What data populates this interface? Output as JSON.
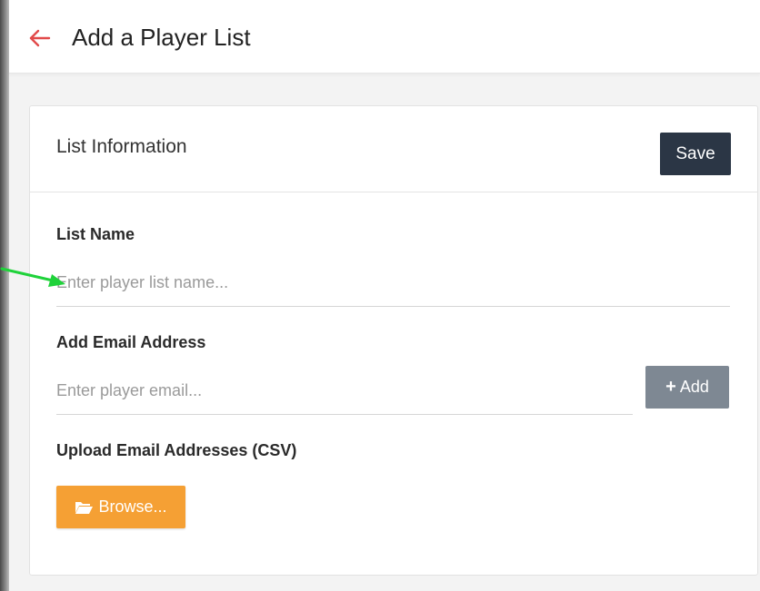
{
  "header": {
    "title": "Add a Player List"
  },
  "card": {
    "title": "List Information",
    "save_label": "Save"
  },
  "list_name": {
    "label": "List Name",
    "placeholder": "Enter player list name...",
    "value": ""
  },
  "email": {
    "label": "Add Email Address",
    "placeholder": "Enter player email...",
    "value": "",
    "add_label": "Add"
  },
  "upload": {
    "label": "Upload Email Addresses (CSV)",
    "browse_label": "Browse..."
  },
  "icons": {
    "back": "arrow-left-icon",
    "add": "plus-icon",
    "browse": "folder-open-icon",
    "annotation": "annotation-arrow"
  },
  "colors": {
    "back_arrow": "#e14a4a",
    "save_button": "#2b3645",
    "add_button": "#7e8893",
    "browse_button": "#f5a034",
    "annotation": "#1fd23a"
  }
}
